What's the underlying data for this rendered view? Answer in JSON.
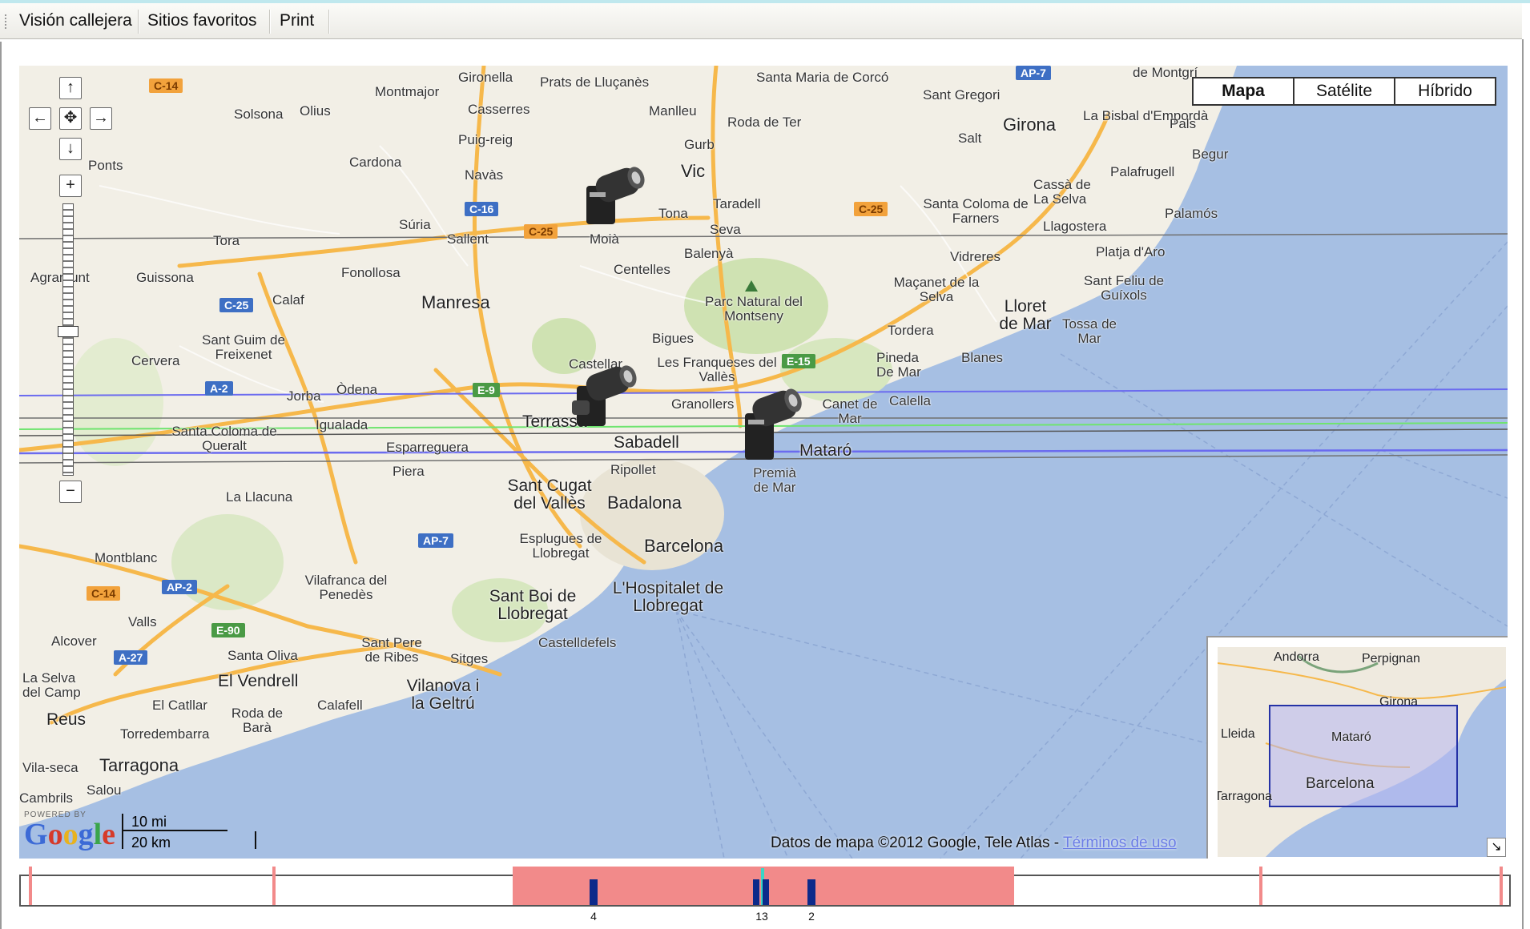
{
  "toolbar": {
    "items": [
      "Visión callejera",
      "Sitios favoritos",
      "Print"
    ]
  },
  "map": {
    "type_buttons": [
      "Mapa",
      "Satélite",
      "Híbrido"
    ],
    "active_type": "Mapa",
    "controls": {
      "pan_up": "↑",
      "pan_left": "←",
      "pan_center": "✥",
      "pan_right": "→",
      "pan_down": "↓",
      "zoom_in": "+",
      "zoom_out": "−",
      "zoom_level_fraction": 0.47
    },
    "labels": {
      "towns": [
        "Gironella",
        "Prats de Lluçanès",
        "Santa Maria de Corcó",
        "de Montgrí",
        "Montmajor",
        "Casserres",
        "Manlleu",
        "Roda de Ter",
        "Sant Gregori",
        "La Bisbal d'Empordà",
        "Pals",
        "Solsona",
        "Olius",
        "Puig-reig",
        "Gurb",
        "Salt",
        "Girona",
        "Begur",
        "Cardona",
        "Navàs",
        "Vic",
        "Palafrugell",
        "Ponts",
        "Cassà de La Selva",
        "Súria",
        "Tona",
        "Taradell",
        "Santa Coloma de Farners",
        "Palamós",
        "Tora",
        "Sallent",
        "Moià",
        "Seva",
        "Llagostera",
        "Balenyà",
        "Vidreres",
        "Platja d'Aro",
        "Agramunt",
        "Guissona",
        "Fonollosa",
        "Centelles",
        "Maçanet de la Selva",
        "Sant Feliu de Guíxols",
        "Calaf",
        "Manresa",
        "Parc Natural del Montseny",
        "Lloret de Mar",
        "Tossa de Mar",
        "Sant Guim de Freixenet",
        "Bigues",
        "Tordera",
        "Cervera",
        "Castellar",
        "Les Franqueses del Vallès",
        "Pineda De Mar",
        "Blanes",
        "Jorba",
        "Òdena",
        "Granollers",
        "Canet de Mar",
        "Calella",
        "Santa Coloma de Queralt",
        "Igualada",
        "Terrassa",
        "Sabadell",
        "Esparreguera",
        "Mataró",
        "Piera",
        "Ripollet",
        "Premià de Mar",
        "Sant Cugat del Vallès",
        "Badalona",
        "La Llacuna",
        "Esplugues de Llobregat",
        "Barcelona",
        "Montblanc",
        "Vilafranca del Penedès",
        "Sant Boi de Llobregat",
        "L'Hospitalet de Llobregat",
        "Valls",
        "Castelldefels",
        "Alcover",
        "Santa Oliva",
        "Sant Pere de Ribes",
        "Sitges",
        "La Selva del Camp",
        "El Vendrell",
        "Vilanova i la Geltrú",
        "El Catllar",
        "Calafell",
        "Reus",
        "Roda de Barà",
        "Torredembarra",
        "Tarragona",
        "Vila-seca",
        "Salou",
        "Cambrils"
      ],
      "road_shields": [
        "C-14",
        "AP-7",
        "C-16",
        "C-25",
        "C-25",
        "C-25",
        "E-9",
        "A-2",
        "E-15",
        "AP-7",
        "AP-2",
        "C-14",
        "E-90",
        "A-27"
      ]
    },
    "scale": {
      "miles": "10 mi",
      "km": "20 km"
    },
    "branding": {
      "powered_by": "POWERED BY",
      "logo": "Google"
    },
    "copyright": {
      "text": "Datos de mapa ©2012 Google, Tele Atlas - ",
      "terms_link": "Términos de uso"
    },
    "markers": [
      {
        "icon": "camera-icon",
        "near": "Moià"
      },
      {
        "icon": "camera-icon",
        "near": "Castellar"
      },
      {
        "icon": "camera-icon",
        "near": "Granollers"
      }
    ],
    "overview": {
      "labels": [
        "Andorra",
        "Perpignan",
        "Girona",
        "Lleida",
        "Mataró",
        "Barcelona",
        "Tarragona"
      ],
      "toggle": "↘"
    }
  },
  "timeline": {
    "numbers": [
      "4",
      "13",
      "2"
    ]
  }
}
